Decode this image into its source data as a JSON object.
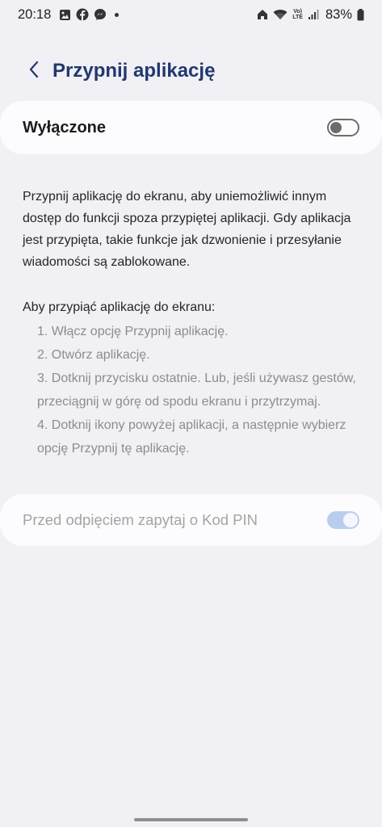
{
  "status_bar": {
    "time": "20:18",
    "battery_percent": "83%",
    "left_icons": [
      "gallery-icon",
      "facebook-icon",
      "messenger-icon",
      "notification-dot"
    ],
    "right_icons": [
      "home-icon",
      "wifi-icon",
      "volte-lte-icon",
      "signal-icon",
      "battery-icon"
    ],
    "volte_label": "Vo)",
    "lte_label": "LTE"
  },
  "header": {
    "title": "Przypnij aplikację",
    "back_icon": "chevron-left-icon"
  },
  "main_toggle": {
    "label": "Wyłączone",
    "state": "off"
  },
  "description": "Przypnij aplikację do ekranu, aby uniemożliwić innym dostęp do funkcji spoza przypiętej aplikacji. Gdy aplikacja jest przypięta, takie funkcje jak dzwonienie i przesyłanie wiadomości są zablokowane.",
  "instructions": {
    "intro": "Aby przypiąć aplikację do ekranu:",
    "steps": [
      "1. Włącz opcję Przypnij aplikację.",
      "2. Otwórz aplikację.",
      "3. Dotknij przycisku ostatnie. Lub, jeśli używasz gestów, przeciągnij w górę od spodu ekranu i przytrzymaj.",
      "4. Dotknij ikony powyżej aplikacji, a następnie wybierz opcję Przypnij tę aplikację."
    ]
  },
  "pin_option": {
    "label": "Przed odpięciem zapytaj o Kod PIN",
    "state": "on",
    "enabled": false
  },
  "colors": {
    "background": "#f0f0f5",
    "card": "#fcfcfe",
    "title": "#22386e",
    "toggle_disabled_on": "#b9cdef"
  }
}
